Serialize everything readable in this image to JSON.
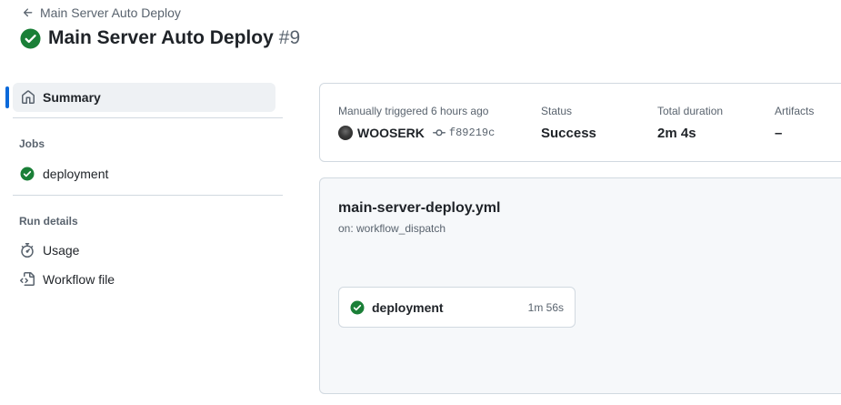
{
  "header": {
    "back_label": "Main Server Auto Deploy",
    "title": "Main Server Auto Deploy",
    "run_number": "#9"
  },
  "sidebar": {
    "summary_label": "Summary",
    "jobs_heading": "Jobs",
    "jobs": [
      {
        "label": "deployment",
        "status": "success"
      }
    ],
    "run_details_heading": "Run details",
    "run_details": [
      {
        "label": "Usage",
        "icon": "stopwatch-icon"
      },
      {
        "label": "Workflow file",
        "icon": "file-code-icon"
      }
    ]
  },
  "run_info": {
    "trigger_label": "Manually triggered 6 hours ago",
    "user": "WOOSERK",
    "commit": "f89219c",
    "status_label": "Status",
    "status_value": "Success",
    "duration_label": "Total duration",
    "duration_value": "2m 4s",
    "artifacts_label": "Artifacts",
    "artifacts_value": "–"
  },
  "workflow": {
    "file_name": "main-server-deploy.yml",
    "trigger": "on: workflow_dispatch",
    "job": {
      "name": "deployment",
      "duration": "1m 56s",
      "status": "success"
    }
  },
  "colors": {
    "success": "#1a7f37",
    "accent": "#0969da",
    "muted_text": "#59636e",
    "border": "#d1d9e0"
  }
}
